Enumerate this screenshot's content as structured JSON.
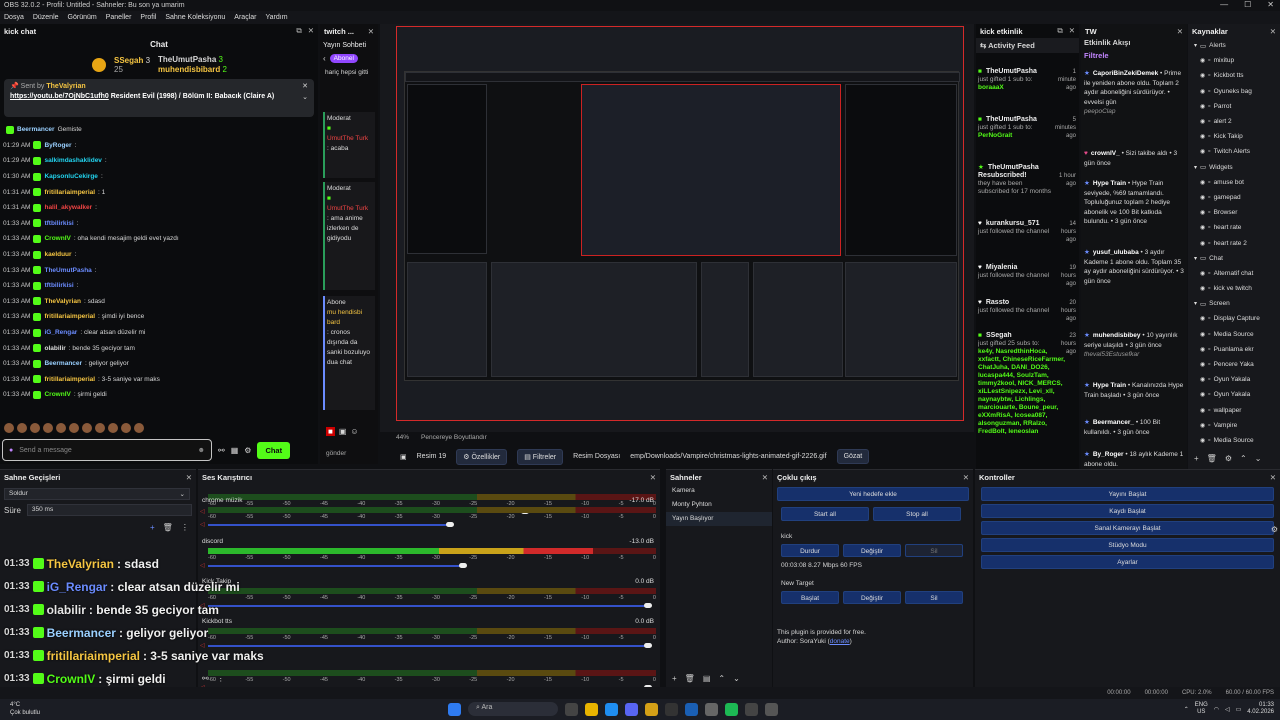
{
  "titlebar": {
    "title": "OBS 32.0.2 - Profil: Untitled - Sahneler: Bu son ya umarim"
  },
  "menu": [
    "Dosya",
    "Düzenle",
    "Görünüm",
    "Paneller",
    "Profil",
    "Sahne Koleksiyonu",
    "Araçlar",
    "Yardım"
  ],
  "kick": {
    "dock_title": "kick chat",
    "title": "Chat",
    "top": [
      {
        "name": "SSegah",
        "count": "3",
        "sub": "25"
      },
      {
        "name": "TheUmutPasha",
        "count": "3"
      },
      {
        "name": "muhendisbibard",
        "count": "2"
      }
    ],
    "pinned": {
      "sent_by": "Sent by",
      "user": "TheValyrian",
      "link": "https://youtu.be/7OjNbC1ufh0",
      "text": " Resident Evil (1998) / Bölüm II: Babacık (Claire A)"
    },
    "messages": [
      {
        "time": "",
        "user": "Beermancer",
        "text": "Gemiste",
        "color": "#9ad0ff"
      },
      {
        "time": "01:29 AM",
        "user": "ByRoger",
        "text": ":",
        "color": "#9ad0ff"
      },
      {
        "time": "01:29 AM",
        "user": "salkimdashaklidev",
        "text": ":",
        "color": "#22d3ee"
      },
      {
        "time": "01:30 AM",
        "user": "KapsonluCekirge",
        "text": ":",
        "color": "#22d3ee"
      },
      {
        "time": "01:31 AM",
        "user": "fritillariaimperial",
        "text": ": 1",
        "color": "#f5c542"
      },
      {
        "time": "01:31 AM",
        "user": "halil_akywalker",
        "text": ":",
        "color": "#ef4444"
      },
      {
        "time": "01:33 AM",
        "user": "tftbilirkisi",
        "text": ":",
        "color": "#6b8cff"
      },
      {
        "time": "01:33 AM",
        "user": "CrownIV",
        "text": ": oha kendi mesajim geldi evet yazdı",
        "color": "#53fc18"
      },
      {
        "time": "01:33 AM",
        "user": "kaelduur",
        "text": ":",
        "color": "#f5c542"
      },
      {
        "time": "01:33 AM",
        "user": "TheUmutPasha",
        "text": ":",
        "color": "#6b8cff"
      },
      {
        "time": "01:33 AM",
        "user": "tftbilirkisi",
        "text": ":",
        "color": "#6b8cff"
      },
      {
        "time": "01:33 AM",
        "user": "TheValyrian",
        "text": ": sdasd",
        "color": "#f5c542"
      },
      {
        "time": "01:33 AM",
        "user": "fritillariaimperial",
        "text": ": şimdi iyi bence",
        "color": "#f5c542"
      },
      {
        "time": "01:33 AM",
        "user": "iG_Rengar",
        "text": ": clear atsan düzelir mi",
        "color": "#6b8cff"
      },
      {
        "time": "01:33 AM",
        "user": "olabilir",
        "text": ": bende 35 geciyor tam",
        "color": "#ddd"
      },
      {
        "time": "01:33 AM",
        "user": "Beermancer",
        "text": ": geliyor geliyor",
        "color": "#9ad0ff"
      },
      {
        "time": "01:33 AM",
        "user": "fritillariaimperial",
        "text": ": 3-5 saniye var maks",
        "color": "#f5c542"
      },
      {
        "time": "01:33 AM",
        "user": "CrownIV",
        "text": ": şirmi geldi",
        "color": "#53fc18"
      }
    ],
    "input_placeholder": "Send a message",
    "chat_button": "Chat"
  },
  "twitch": {
    "dock_title": "twitch ...",
    "yayin": "Yayın Sohbeti",
    "abonel": "Abonel",
    "pre": "hariç hepsi gitti",
    "msg1": {
      "role": "Moderat",
      "user": "UmutThe Turk",
      "text": ": acaba"
    },
    "msg2": {
      "role": "Moderat",
      "user": "UmutThe Turk",
      "text": ": ama anime izlerken de gidiyodu"
    },
    "msg3": {
      "role": "Abone",
      "user": "mu hendisbi bard",
      "text": ": cronos dışında da sanki bozuluyo dua chat"
    },
    "gonder": "gönder"
  },
  "preview": {
    "zoom": "44%",
    "fit": "Pencereye Boyutlandır"
  },
  "toolbar": {
    "scene": "Resim 19",
    "props": "Özellikler",
    "filters": "Filtreler",
    "file_label": "Resim Dosyası",
    "file_path": "emp/Downloads/Vampire/christmas-lights-animated-gif-2226.gif",
    "browse": "Gözat"
  },
  "kickact": {
    "dock_title": "kick etkinlik",
    "title": "Activity Feed",
    "items": [
      {
        "user": "TheUmutPasha",
        "ago": "1 minute ago",
        "text": "just gifted 1 sub to:",
        "extra": "boraaaX"
      },
      {
        "user": "TheUmutPasha",
        "ago": "5 minutes ago",
        "text": "just gifted 1 sub to:",
        "extra": "PerNoGrait"
      },
      {
        "user": "TheUmutPasha Resubscribed!",
        "ago": "1 hour ago",
        "text": "they have been subscribed for 17 months",
        "extra": ""
      },
      {
        "user": "kurankursu_571",
        "ago": "14 hours ago",
        "text": "just followed the channel",
        "extra": ""
      },
      {
        "user": "Miyalenia",
        "ago": "19 hours ago",
        "text": "just followed the channel",
        "extra": ""
      },
      {
        "user": "Rassto",
        "ago": "20 hours ago",
        "text": "just followed the channel",
        "extra": ""
      },
      {
        "user": "SSegah",
        "ago": "23 hours ago",
        "text": "just gifted 25 subs to:",
        "extra": "ke4y, NasredthinHoca, xxfactt, ChineseRiceFarmer, ChatJuha, DANI_DO26, lucaspa444, SoulzTam, timmy2kool, NICK_MERCS, xiLLestSnipezx, Levi_xll, naynaybtw, Lichlings, marciouarte, Boune_peur, eXXmRisA, lcosea087, alsonguzman, RRalzo, FredBolt, leneoslan"
      }
    ]
  },
  "twact": {
    "dock_title": "TW",
    "title": "Etkinlik Akışı",
    "filter": "Filtrele",
    "items": [
      {
        "user": "CaporiBinZekiDemek",
        "text": "• Prime ile yeniden abone oldu. Toplam 2 aydır aboneliğini sürdürüyor. • evvelsi gün",
        "note": "peepoClap"
      },
      {
        "user": "crownIV_",
        "text": "• Sizi takibe aldı • 3 gün önce",
        "note": ""
      },
      {
        "user": "Hype Train",
        "text": "• Hype Train seviyede, %69 tamamlandı. Topluluğunuz toplam 2 hediye abonelik ve 100 Bit katkıda bulundu. • 3 gün önce",
        "note": ""
      },
      {
        "user": "yusuf_ulubaba",
        "text": "• 3 aydır Kademe 1 abone oldu. Toplam 35 ay aydır aboneliğini sürdürüyor. • 3 gün önce",
        "note": ""
      },
      {
        "user": "muhendisbibey",
        "text": "• 10 yayınlık seriye ulaşıldı • 3 gün önce",
        "note": "theval53Estusefkar"
      },
      {
        "user": "Hype Train",
        "text": "• Kanalınızda Hype Train başladı • 3 gün önce",
        "note": ""
      },
      {
        "user": "Beermancer_",
        "text": "• 100 Bit kullanıldı. • 3 gün önce",
        "note": ""
      },
      {
        "user": "By_Roger",
        "text": "• 18 aylık Kademe 1 abone oldu.",
        "note": ""
      }
    ]
  },
  "sources": {
    "dock_title": "Kaynaklar",
    "items": [
      {
        "name": "Alerts",
        "level": 0,
        "folder": true
      },
      {
        "name": "mixitup",
        "level": 1
      },
      {
        "name": "Kickbot tts",
        "level": 1
      },
      {
        "name": "Oyuneks bag",
        "level": 1
      },
      {
        "name": "Parrot",
        "level": 1
      },
      {
        "name": "alert 2",
        "level": 1
      },
      {
        "name": "Kick Takip",
        "level": 1
      },
      {
        "name": "Twitch Alerts",
        "level": 1
      },
      {
        "name": "Widgets",
        "level": 0,
        "folder": true
      },
      {
        "name": "amuse bot",
        "level": 1
      },
      {
        "name": "gamepad",
        "level": 1
      },
      {
        "name": "Browser",
        "level": 1
      },
      {
        "name": "heart rate",
        "level": 1
      },
      {
        "name": "heart rate 2",
        "level": 1
      },
      {
        "name": "Chat",
        "level": 0,
        "folder": true
      },
      {
        "name": "Alternatif chat",
        "level": 1
      },
      {
        "name": "kick ve twitch",
        "level": 1
      },
      {
        "name": "Screen",
        "level": 0,
        "folder": true
      },
      {
        "name": "Display Capture",
        "level": 1
      },
      {
        "name": "Media Source",
        "level": 1
      },
      {
        "name": "Puanlama ekr",
        "level": 1
      },
      {
        "name": "Pencere Yaka",
        "level": 1
      },
      {
        "name": "Oyun Yakala",
        "level": 1
      },
      {
        "name": "Oyun Yakala",
        "level": 1
      },
      {
        "name": "wallpaper",
        "level": 1
      },
      {
        "name": "Vampire",
        "level": 1
      },
      {
        "name": "Media Source",
        "level": 1
      }
    ]
  },
  "transitions": {
    "title": "Sahne Geçişleri",
    "type": "Soldur",
    "dur_label": "Süre",
    "duration": "350 ms"
  },
  "mixer": {
    "title": "Ses Karıştırıcı",
    "channels": [
      {
        "name": "",
        "db": "",
        "level": 0.0,
        "vol": 0.72
      },
      {
        "name": "chrome müzik",
        "db": "-17.0 dB",
        "level": 0.0,
        "vol": 0.55
      },
      {
        "name": "discord",
        "db": "-13.0 dB",
        "level": 0.86,
        "vol": 0.58
      },
      {
        "name": "Kick Takip",
        "db": "0.0 dB",
        "level": 0.0,
        "vol": 1.0
      },
      {
        "name": "Kickbot tts",
        "db": "0.0 dB",
        "level": 0.0,
        "vol": 1.0
      },
      {
        "name": "",
        "db": "",
        "level": 0.0,
        "vol": 1.0
      }
    ],
    "scale": [
      "-60",
      "-55",
      "-50",
      "-45",
      "-40",
      "-35",
      "-30",
      "-25",
      "-20",
      "-15",
      "-10",
      "-5",
      "0"
    ]
  },
  "scenes": {
    "title": "Sahneler",
    "items": [
      "Kamera",
      "Monty Pyhton",
      "Yayın Başlıyor"
    ],
    "active": 2
  },
  "multi": {
    "title": "Çoklu çıkış",
    "new_target": "Yeni hedefe ekle",
    "start_all": "Start all",
    "stop_all": "Stop all",
    "kick": {
      "name": "kick",
      "stop": "Durdur",
      "edit": "Değiştir",
      "del": "Sil",
      "stats": "00:03:08  8.27 Mbps  60 FPS"
    },
    "nt": {
      "name": "New Target",
      "start": "Başlat",
      "edit": "Değiştir",
      "del": "Sil"
    },
    "footer": "This plugin is provided for free.",
    "author_label": "Author: SoraYuki (",
    "author_link": "donate",
    "author_end": ")"
  },
  "controls": {
    "title": "Kontroller",
    "buttons": [
      "Yayını Başlat",
      "Kaydı Başlat",
      "Sanal Kamerayı Başlat",
      "Stüdyo Modu",
      "Ayarlar"
    ]
  },
  "overlay": [
    {
      "time": "01:33",
      "user": "TheValyrian",
      "text": ": sdasd",
      "color": "#f5c542"
    },
    {
      "time": "01:33",
      "user": "iG_Rengar",
      "text": ": clear atsan düzelir mi",
      "color": "#6b8cff"
    },
    {
      "time": "01:33",
      "user": "olabilir",
      "text": ": bende 35 geciyor tam",
      "color": "#e5e5e5"
    },
    {
      "time": "01:33",
      "user": "Beermancer",
      "text": ": geliyor geliyor",
      "color": "#9ad0ff"
    },
    {
      "time": "01:33",
      "user": "fritillariaimperial",
      "text": ": 3-5 saniye var maks",
      "color": "#f5c542"
    },
    {
      "time": "01:33",
      "user": "CrownIV",
      "text": ": şirmi geldi",
      "color": "#53fc18"
    }
  ],
  "status": {
    "rec": "00:00:00",
    "live": "00:00:00",
    "cpu": "CPU: 2.0%",
    "fps": "60.00 / 60.00 FPS"
  },
  "taskbar": {
    "temp": "4°C",
    "weather": "Çok bulutlu",
    "search": "Ara",
    "lang1": "ENG",
    "lang2": "US",
    "time": "01:33",
    "date": "4.02.2026"
  }
}
